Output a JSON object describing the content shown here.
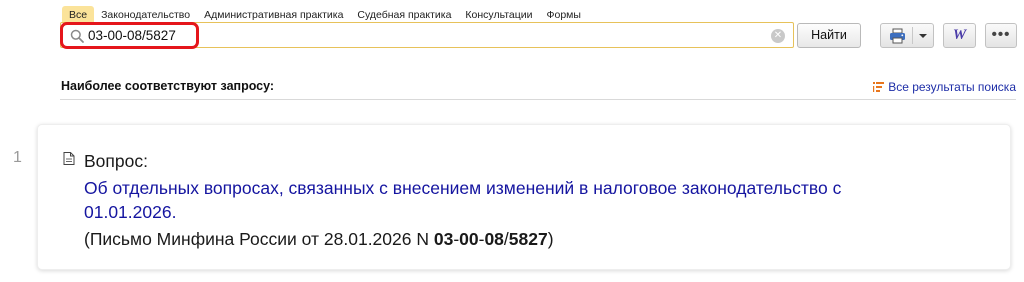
{
  "tabs": [
    "Все",
    "Законодательство",
    "Административная практика",
    "Судебная практика",
    "Консультации",
    "Формы"
  ],
  "search": {
    "value": "03-00-08/5827",
    "find_label": "Найти"
  },
  "toolbar": {
    "word_label": "W",
    "more_label": "•••"
  },
  "section": {
    "title": "Наиболее соответствуют запросу:",
    "all_results_label": "Все результаты поиска"
  },
  "results": [
    {
      "number": "1",
      "kind_label": "Вопрос:",
      "title": "Об отдельных вопросах, связанных с внесением изменений в налоговое законодательство с 01.01.2026.",
      "source_prefix": "(Письмо Минфина России от 28.01.2026 N ",
      "source_parts": [
        "03",
        "-",
        "00",
        "-",
        "08",
        "/",
        "5827"
      ],
      "source_suffix": ")"
    }
  ],
  "colors": {
    "active_tab": "#fbe39a",
    "search_border": "#e7c25a",
    "highlight": "#e5161b",
    "link": "#1515a0"
  }
}
